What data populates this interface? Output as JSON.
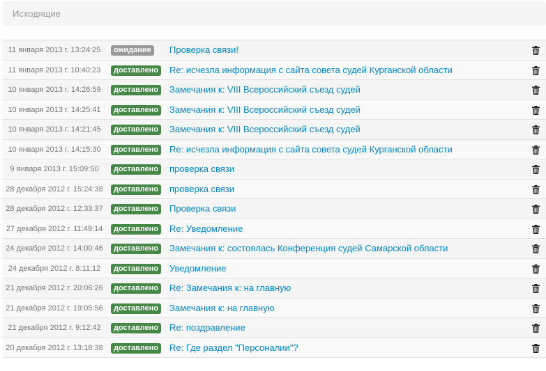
{
  "header": {
    "title": "Исходящие"
  },
  "messages": [
    {
      "date": "11 января 2013 г. 13:24:25",
      "status": "ожидание",
      "status_kind": "wait",
      "subject": "Проверка связи!"
    },
    {
      "date": "11 января 2013 г. 10:40:23",
      "status": "доставлено",
      "status_kind": "ok",
      "subject": "Re: исчезла информация с сайта совета судей Курганской области"
    },
    {
      "date": "10 января 2013 г. 14:26:59",
      "status": "доставлено",
      "status_kind": "ok",
      "subject": "Замечания к: VIII Всероссийский съезд судей"
    },
    {
      "date": "10 января 2013 г. 14:25:41",
      "status": "доставлено",
      "status_kind": "ok",
      "subject": "Замечания к: VIII Всероссийский съезд судей"
    },
    {
      "date": "10 января 2013 г. 14:21:45",
      "status": "доставлено",
      "status_kind": "ok",
      "subject": "Замечания к: VIII Всероссийский съезд судей"
    },
    {
      "date": "10 января 2013 г. 14:15:30",
      "status": "доставлено",
      "status_kind": "ok",
      "subject": "Re: исчезла информация с сайта совета судей Курганской области"
    },
    {
      "date": "9 января 2013 г. 15:09:50",
      "status": "доставлено",
      "status_kind": "ok",
      "subject": "проверка связи"
    },
    {
      "date": "28 декабря 2012 г. 15:24:38",
      "status": "доставлено",
      "status_kind": "ok",
      "subject": "проверка связи"
    },
    {
      "date": "28 декабря 2012 г. 12:33:37",
      "status": "доставлено",
      "status_kind": "ok",
      "subject": "Проверка связи"
    },
    {
      "date": "27 декабря 2012 г. 11:49:14",
      "status": "доставлено",
      "status_kind": "ok",
      "subject": "Re: Уведомление"
    },
    {
      "date": "24 декабря 2012 г. 14:00:46",
      "status": "доставлено",
      "status_kind": "ok",
      "subject": "Замечания к: состоялась Конференция судей Самарской области"
    },
    {
      "date": "24 декабря 2012 г. 8:11:12",
      "status": "доставлено",
      "status_kind": "ok",
      "subject": "Уведомление"
    },
    {
      "date": "21 декабря 2012 г. 20:06:26",
      "status": "доставлено",
      "status_kind": "ok",
      "subject": "Re: Замечания к: на главную"
    },
    {
      "date": "21 декабря 2012 г. 19:05:56",
      "status": "доставлено",
      "status_kind": "ok",
      "subject": "Замечания к: на главную"
    },
    {
      "date": "21 декабря 2012 г. 9:12:42",
      "status": "доставлено",
      "status_kind": "ok",
      "subject": "Re: поздравление"
    },
    {
      "date": "20 декабря 2012 г. 13:18:38",
      "status": "доставлено",
      "status_kind": "ok",
      "subject": "Re: Где раздел \"Персоналии\"?"
    }
  ],
  "icons": {
    "delete": "trash-icon"
  },
  "colors": {
    "link": "#0088cc",
    "delivered": "#468847",
    "pending": "#999999"
  }
}
